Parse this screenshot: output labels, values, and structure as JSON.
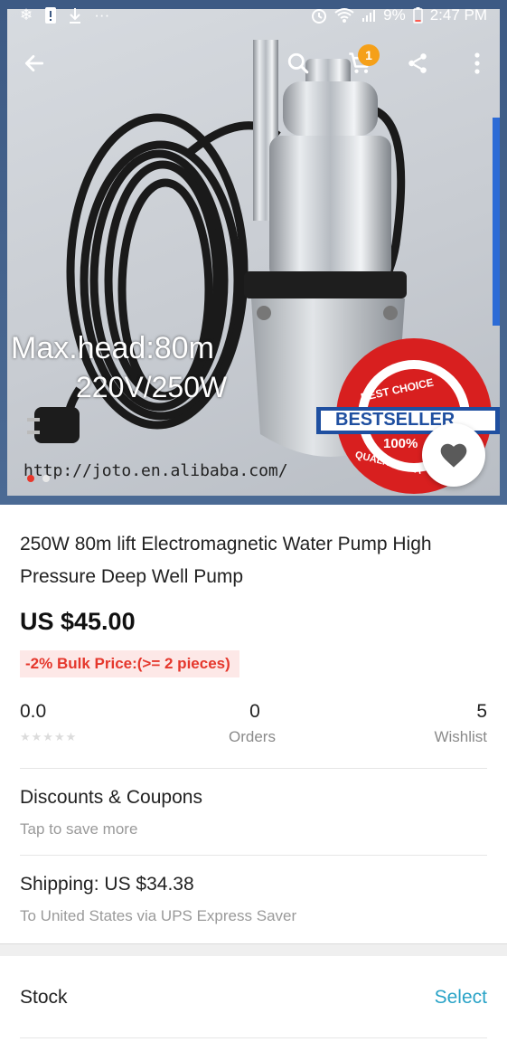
{
  "status_bar": {
    "battery": "9%",
    "time": "2:47 PM"
  },
  "toolbar": {
    "cart_count": "1"
  },
  "hero": {
    "overlay_line1": "Max.head:80m",
    "overlay_line2": "220V/250W",
    "badge_top": "BEST CHOICE",
    "badge_ribbon": "BESTSELLER",
    "badge_pct": "100%",
    "badge_bottom": "QUALITY GUA",
    "url": "http://joto.en.alibaba.com/",
    "image_count": 2,
    "active_index": 0
  },
  "product": {
    "title": "250W 80m lift Electromagnetic Water Pump High Pressure Deep Well Pump",
    "price": "US $45.00",
    "bulk_price": "-2% Bulk Price:(>= 2 pieces)"
  },
  "stats": {
    "rating": "0.0",
    "rating_stars": 0,
    "orders_count": "0",
    "orders_label": "Orders",
    "wishlist_count": "5",
    "wishlist_label": "Wishlist"
  },
  "discounts": {
    "title": "Discounts & Coupons",
    "subtitle": "Tap to save more"
  },
  "shipping": {
    "title": "Shipping: US $34.38",
    "subtitle": "To United States via UPS Express Saver"
  },
  "stock": {
    "label": "Stock",
    "action": "Select"
  },
  "colors": {
    "accent_red": "#e5372c",
    "select_blue": "#2aa3c7",
    "badge_orange": "#f5a019"
  }
}
